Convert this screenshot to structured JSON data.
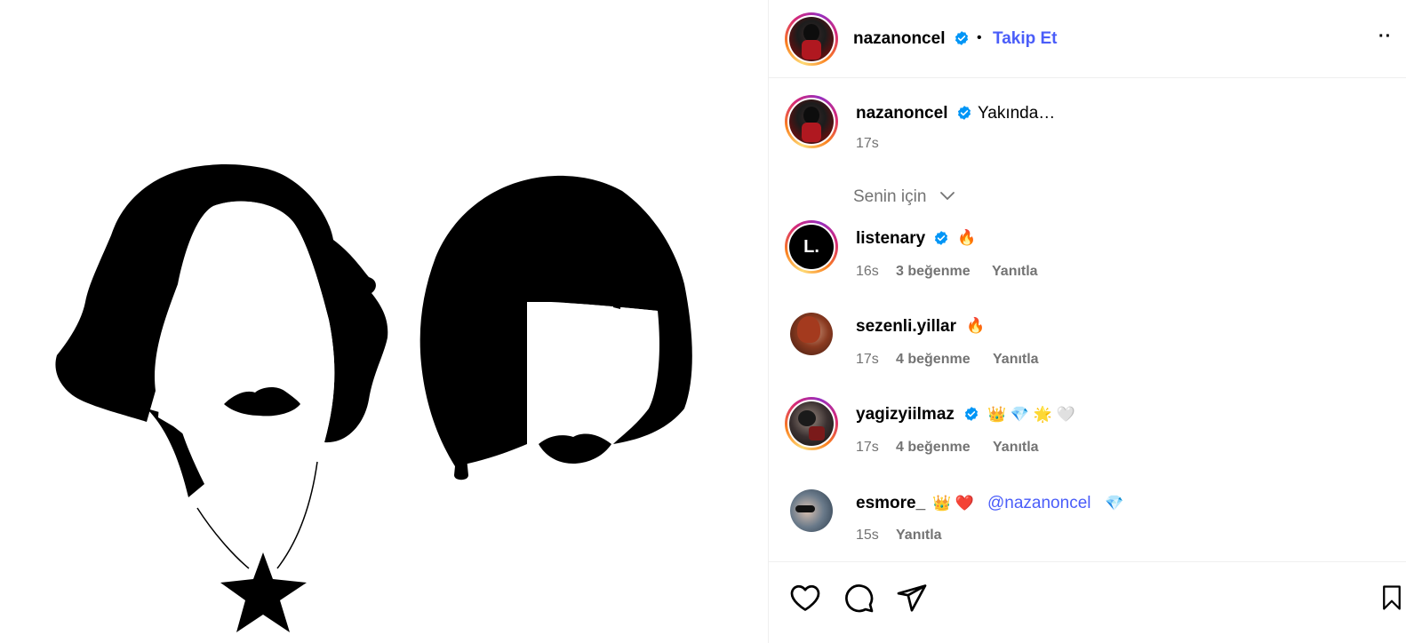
{
  "post": {
    "author": "nazanoncel",
    "follow_label": "Takip Et",
    "more_label": "··",
    "caption": "Yakında…",
    "caption_time": "17s",
    "filter_label": "Senin için"
  },
  "comments": [
    {
      "username": "listenary",
      "verified": true,
      "text_emoji": "🔥",
      "time": "16s",
      "likes": "3 beğenme",
      "reply": "Yanıtla",
      "avatar_letter": "L."
    },
    {
      "username": "sezenli.yillar",
      "verified": false,
      "text_emoji": "🔥",
      "time": "17s",
      "likes": "4 beğenme",
      "reply": "Yanıtla"
    },
    {
      "username": "yagizyiilmaz",
      "verified": true,
      "text_emoji": "👑 💎 🌟 🤍",
      "time": "17s",
      "likes": "4 beğenme",
      "reply": "Yanıtla"
    },
    {
      "username": "esmore_",
      "verified": false,
      "text_emoji": "👑 ❤️",
      "mention": "@nazanoncel",
      "after_emoji": "💎",
      "time": "15s",
      "reply": "Yanıtla"
    }
  ],
  "icons": {
    "like": "heart-icon",
    "comment": "comment-icon",
    "share": "share-icon",
    "save": "bookmark-icon"
  },
  "colors": {
    "accent": "#4a5df9",
    "secondary_text": "#737373",
    "verified": "#0095f6"
  }
}
